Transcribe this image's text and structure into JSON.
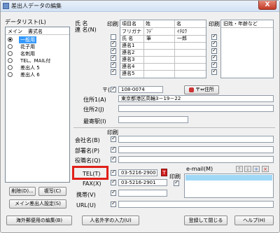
{
  "window": {
    "title": "差出人データの編集",
    "close_glyph": "X"
  },
  "list": {
    "group_label": "データリスト(L)",
    "col_main": "メイン",
    "col_name": "書式名",
    "items": [
      {
        "label": "一般用",
        "selected": true,
        "main": true
      },
      {
        "label": "花子用",
        "selected": false,
        "main": false
      },
      {
        "label": "名刺用",
        "selected": false,
        "main": false
      },
      {
        "label": "TEL、MAIL付",
        "selected": false,
        "main": false
      },
      {
        "label": "差出人 5",
        "selected": false,
        "main": false
      },
      {
        "label": "差出人 6",
        "selected": false,
        "main": false
      }
    ],
    "delete_button": "削除(D)...",
    "copy_button": "複写(C)",
    "main_setting_button": "メイン差出人設定(S)"
  },
  "name_section": {
    "label_line1": "氏 名",
    "label_line2": "連 名(N)",
    "print_label": "印刷",
    "headers": [
      "項目名",
      "姓",
      "名"
    ],
    "rows": [
      {
        "item": "フリガナ",
        "last": "ﾌﾃﾞ",
        "first": "ｲﾁﾛｳ",
        "checked": false
      },
      {
        "item": "氏 名",
        "last": "筆",
        "first": "一郎",
        "checked": true
      },
      {
        "item": "連名1",
        "last": "",
        "first": "",
        "checked": true
      },
      {
        "item": "連名2",
        "last": "",
        "first": "",
        "checked": true
      },
      {
        "item": "連名3",
        "last": "",
        "first": "",
        "checked": true
      },
      {
        "item": "連名4",
        "last": "",
        "first": "",
        "checked": true
      },
      {
        "item": "連名5",
        "last": "",
        "first": "",
        "checked": true
      }
    ],
    "old_name_print": "印刷",
    "old_name_header": "旧姓・年齢など"
  },
  "address": {
    "zip_label": "〒(Z)",
    "zip_value": "108-0074",
    "zip_button": "〒⇔住所",
    "addr1_label": "住所1(A)",
    "addr1_value": "東京都港区高輪3－19－22",
    "addr2_label": "住所2(J)",
    "addr2_value": "",
    "station_label": "最寄駅(I)",
    "station_value": ""
  },
  "company": {
    "print_label": "印刷",
    "company_label": "会社名(B)",
    "dept_label": "部署名(P)",
    "title_label": "役職名(Q)"
  },
  "contact": {
    "tel_label": "TEL(T)",
    "tel_value": "03-5216-2900",
    "fax_label": "FAX(X)",
    "fax_value": "03-5216-2901",
    "mobile_label": "携帯(V)",
    "mobile_value": "",
    "url_label": "URL(U)",
    "url_value": "",
    "print_label": "印刷",
    "email_label": "e-mail(M)"
  },
  "buttons": {
    "overseas": "海外郵便用の編集(B)",
    "gaiji": "人名外字の入力(U)",
    "register_close": "登録して閉じる",
    "help": "ヘルプ(H)"
  },
  "colors": {
    "highlight": "#e0201a",
    "selection": "#3399ff",
    "email_selected": "#9fd8f7"
  }
}
